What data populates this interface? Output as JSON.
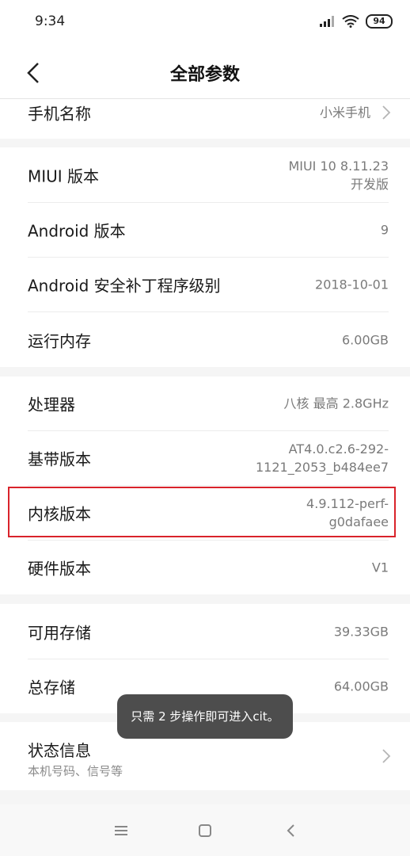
{
  "status_bar": {
    "time": "9:34",
    "battery": "94"
  },
  "header": {
    "title": "全部参数"
  },
  "rows": {
    "phone_name": {
      "label": "手机名称",
      "value": "小米手机"
    },
    "miui": {
      "label": "MIUI 版本",
      "value_line1": "MIUI 10 8.11.23",
      "value_line2": "开发版"
    },
    "android": {
      "label": "Android 版本",
      "value": "9"
    },
    "security_patch": {
      "label": "Android 安全补丁程序级别",
      "value": "2018-10-01"
    },
    "ram": {
      "label": "运行内存",
      "value": "6.00GB"
    },
    "processor": {
      "label": "处理器",
      "value": "八核 最高 2.8GHz"
    },
    "baseband": {
      "label": "基带版本",
      "value_line1": "AT4.0.c2.6-292-",
      "value_line2": "1121_2053_b484ee7"
    },
    "kernel": {
      "label": "内核版本",
      "value_line1": "4.9.112-perf-",
      "value_line2": "g0dafaee"
    },
    "hardware": {
      "label": "硬件版本",
      "value": "V1"
    },
    "available_storage": {
      "label": "可用存储",
      "value": "39.33GB"
    },
    "total_storage": {
      "label": "总存储",
      "value": "64.00GB"
    },
    "status_info": {
      "label": "状态信息",
      "sublabel": "本机号码、信号等"
    }
  },
  "toast": {
    "text": "只需 2 步操作即可进入cit。"
  },
  "colors": {
    "highlight": "#d9232b",
    "toast_bg": "#4d4d4d"
  },
  "icons": {
    "back": "chevron-left-icon",
    "row_arrow": "chevron-right-icon",
    "nav_menu": "menu-icon",
    "nav_home": "square-icon",
    "nav_back": "chevron-left-icon"
  }
}
